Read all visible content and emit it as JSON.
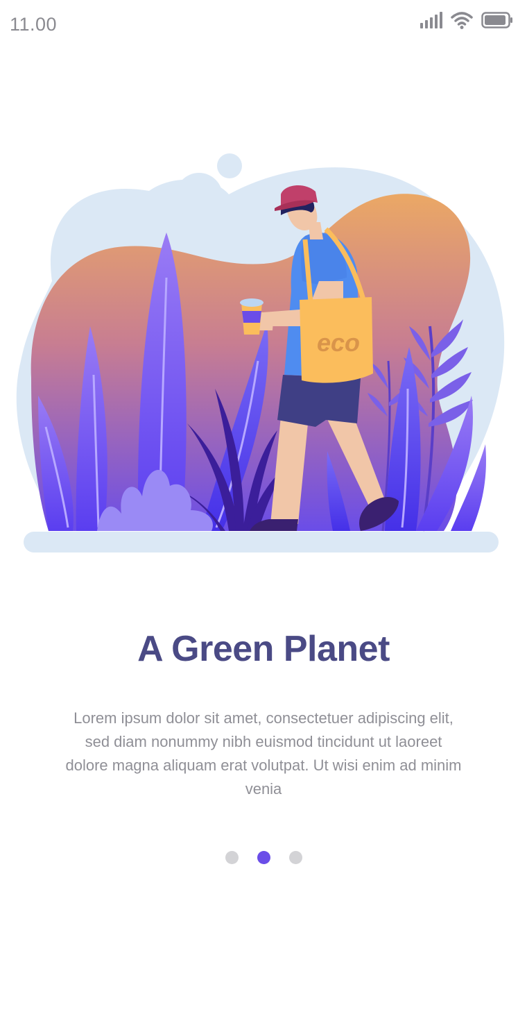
{
  "status_bar": {
    "time": "11.00",
    "icons": [
      "signal-icon",
      "wifi-icon",
      "battery-icon"
    ]
  },
  "illustration": {
    "bag_text": "eco",
    "colors": {
      "blob_bg": "#dbe8f5",
      "blob_warm_top": "#e8a868",
      "blob_warm_bottom": "#6a4de8",
      "leaf": "#6a4de8",
      "bag": "#fbbd5c",
      "shirt": "#4f8cf0",
      "shorts": "#3f3f85",
      "skin": "#f1c6a8",
      "hat": "#c0406a"
    }
  },
  "onboarding": {
    "title": "A Green Planet",
    "description": "Lorem ipsum dolor sit amet, consectetuer adipiscing elit, sed diam nonummy nibh euismod tincidunt ut laoreet dolore magna aliquam erat volutpat. Ut wisi enim ad minim venia"
  },
  "pagination": {
    "total": 3,
    "active_index": 1,
    "colors": {
      "active": "#6a4de8",
      "inactive": "#d3d3d6"
    }
  }
}
